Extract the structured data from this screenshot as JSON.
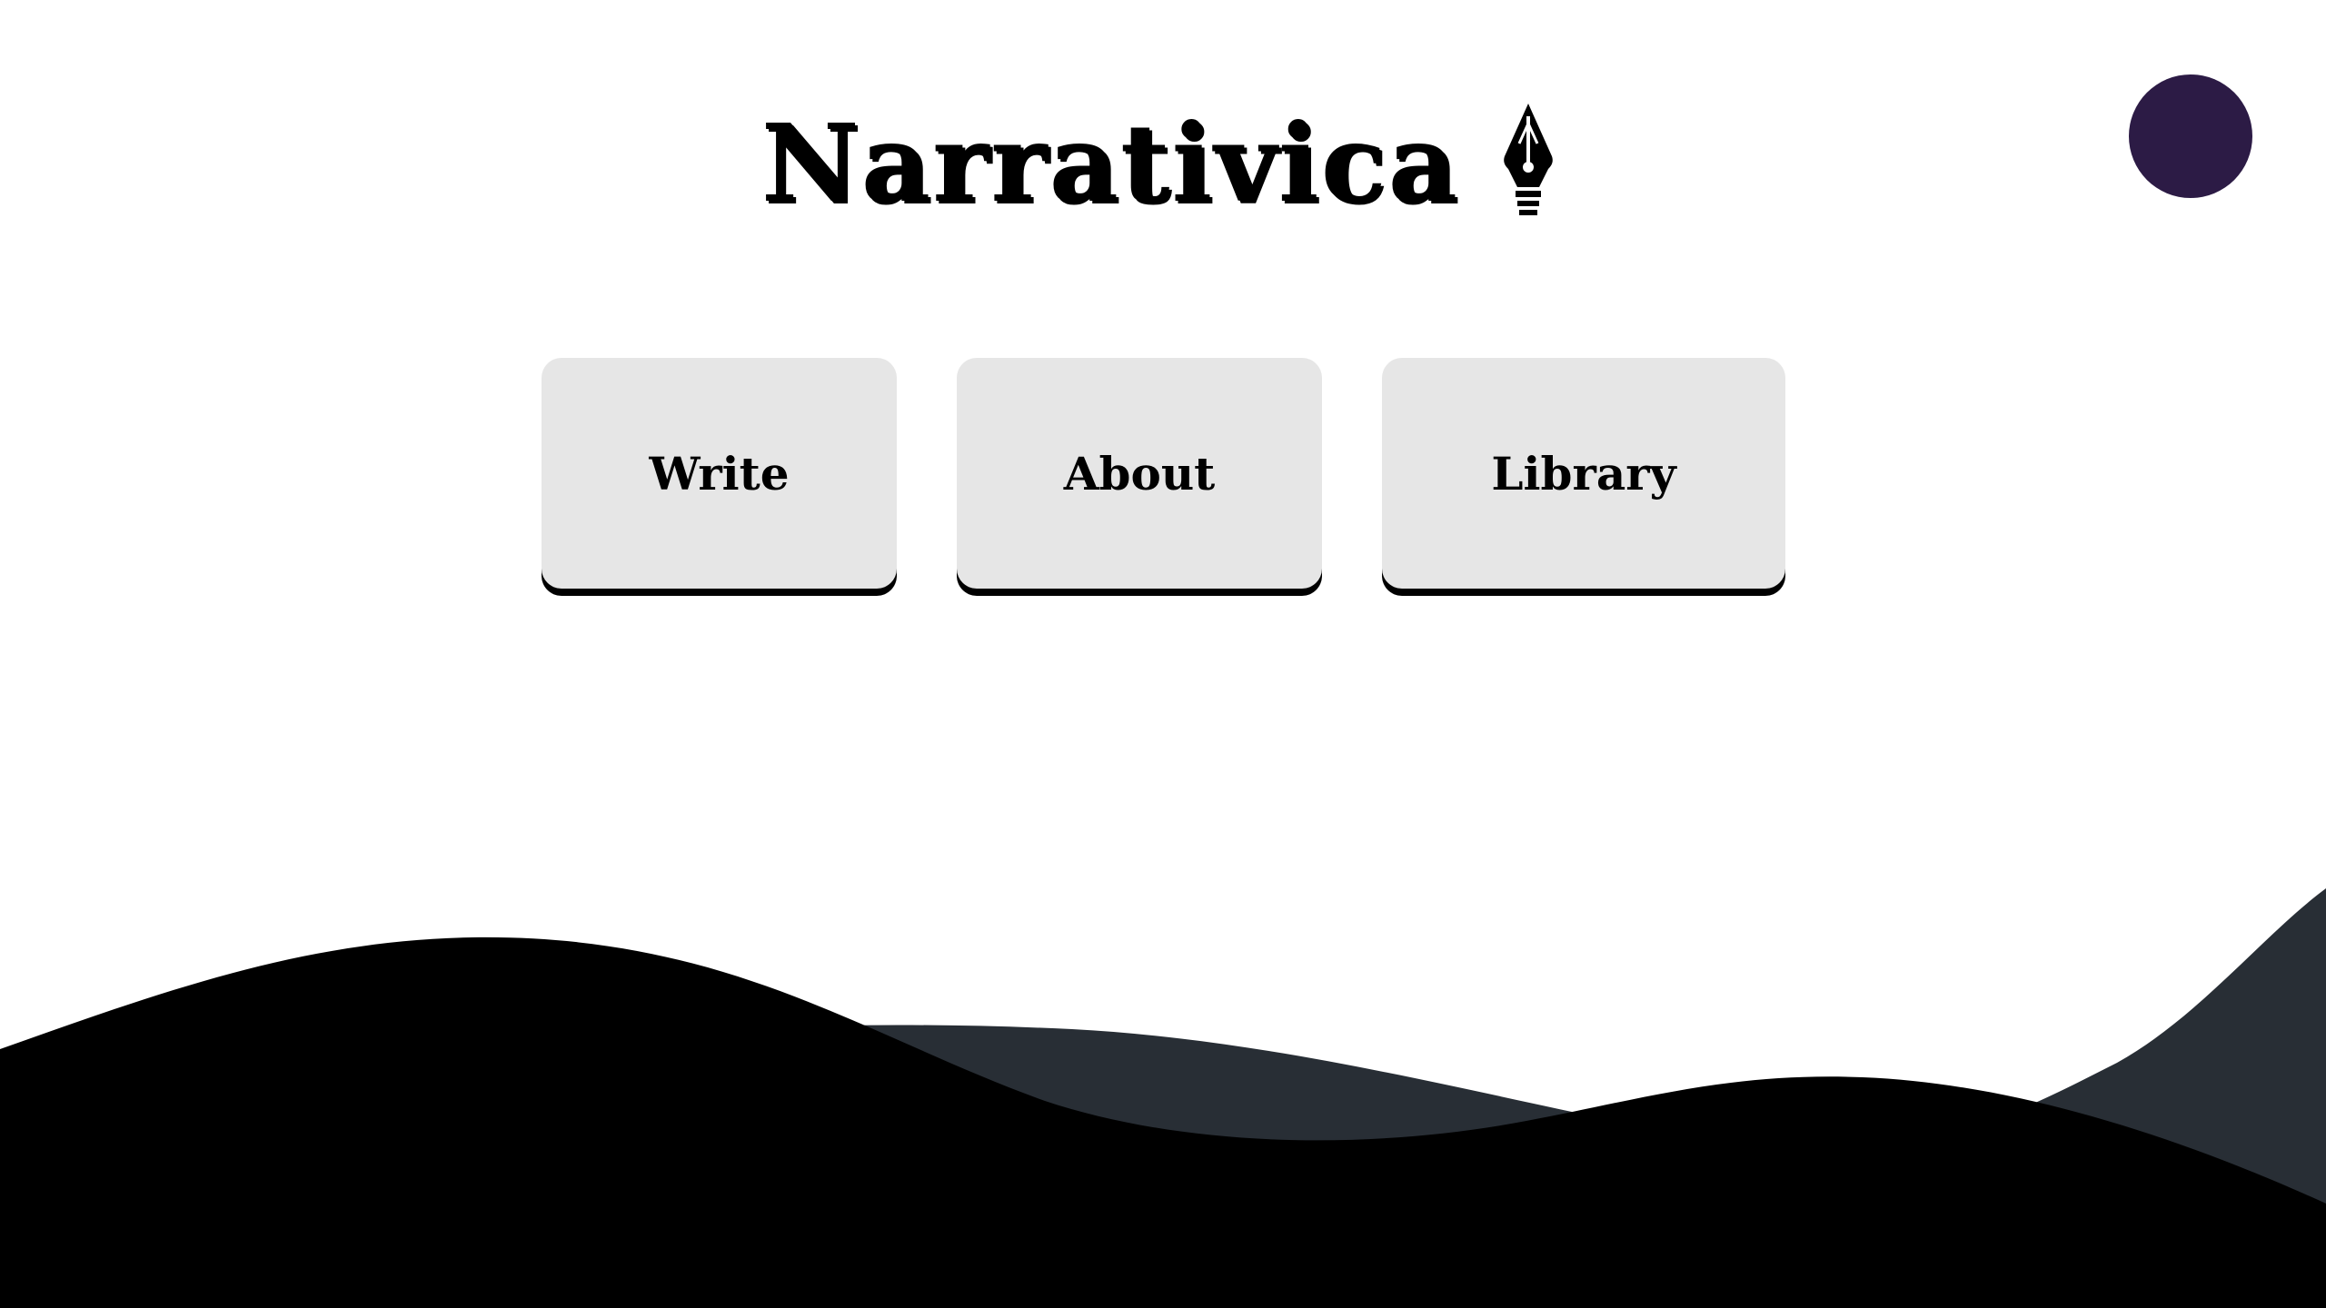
{
  "header": {
    "title": "Narrativica",
    "title_icon": "fountain-pen-nib-icon"
  },
  "profile": {
    "avatar_color": "#2c1b45"
  },
  "nav": {
    "items": [
      {
        "label": "Write"
      },
      {
        "label": "About"
      },
      {
        "label": "Library"
      }
    ]
  },
  "colors": {
    "background": "#ffffff",
    "button_bg": "#e6e6e6",
    "wave_back": "#282e35",
    "wave_front": "#000000"
  }
}
